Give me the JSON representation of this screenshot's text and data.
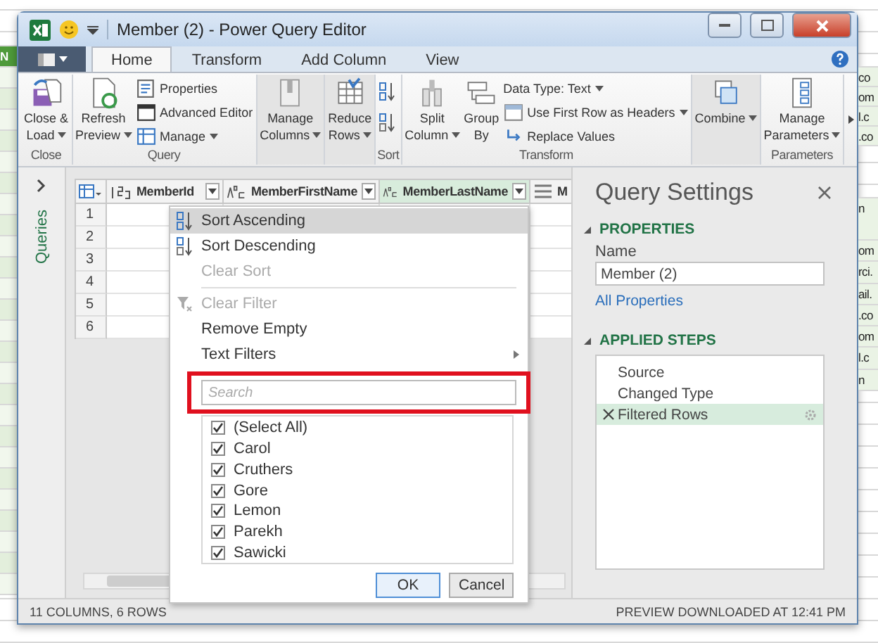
{
  "background_sheet": {
    "left_cell": "N",
    "right_cells_top": [
      "co",
      "om",
      "l.c",
      ".co"
    ],
    "right_cells_lower": [
      "n",
      "om",
      "rci.",
      "ail.",
      ".co",
      "om",
      "l.c",
      "n"
    ]
  },
  "window": {
    "title": "Member (2) - Power Query Editor"
  },
  "tabs": [
    {
      "label": "Home",
      "selected": true
    },
    {
      "label": "Transform",
      "selected": false
    },
    {
      "label": "Add Column",
      "selected": false
    },
    {
      "label": "View",
      "selected": false
    }
  ],
  "ribbon": [
    {
      "label": "Close",
      "items": [
        {
          "kind": "large",
          "lines": [
            "Close &",
            "Load"
          ],
          "dropdown": true
        }
      ]
    },
    {
      "label": "Query",
      "items": [
        {
          "kind": "large",
          "lines": [
            "Refresh",
            "Preview"
          ],
          "dropdown": true
        },
        {
          "kind": "stack",
          "entries": [
            {
              "label": "Properties",
              "dropdown": false
            },
            {
              "label": "Advanced Editor",
              "dropdown": false
            },
            {
              "label": "Manage",
              "dropdown": true
            }
          ]
        }
      ]
    },
    {
      "items": [
        {
          "kind": "large",
          "lines": [
            "Manage",
            "Columns"
          ],
          "dropdown": true
        }
      ]
    },
    {
      "items": [
        {
          "kind": "large",
          "lines": [
            "Reduce",
            "Rows"
          ],
          "dropdown": true
        }
      ]
    },
    {
      "label": "Sort",
      "items": [
        {
          "kind": "sort"
        }
      ]
    },
    {
      "label": "Transform",
      "items": [
        {
          "kind": "large",
          "lines": [
            "Split",
            "Column"
          ],
          "dropdown": true
        },
        {
          "kind": "large",
          "lines": [
            "Group",
            "By"
          ],
          "dropdown": false
        },
        {
          "kind": "stack",
          "entries": [
            {
              "label": "Data Type: Text",
              "dropdown": true
            },
            {
              "label": "Use First Row as Headers",
              "dropdown": true
            },
            {
              "label": "Replace Values",
              "dropdown": false
            }
          ]
        }
      ]
    },
    {
      "items": [
        {
          "kind": "large",
          "lines": [
            "Combine"
          ],
          "dropdown": true
        }
      ]
    },
    {
      "label": "Parameters",
      "items": [
        {
          "kind": "large",
          "lines": [
            "Manage",
            "Parameters"
          ],
          "dropdown": true
        }
      ]
    }
  ],
  "queries_pane": {
    "label": "Queries"
  },
  "table": {
    "columns": [
      {
        "kind": "number",
        "name": "MemberId",
        "selected": false
      },
      {
        "kind": "text",
        "name": "MemberFirstName",
        "selected": false
      },
      {
        "kind": "text",
        "name": "MemberLastName",
        "selected": true
      },
      {
        "kind": "any",
        "name": "M",
        "selected": false
      }
    ],
    "rows": [
      "1",
      "2",
      "3",
      "4",
      "5",
      "6"
    ]
  },
  "filter_menu": {
    "items": [
      {
        "label": "Sort Ascending",
        "kind": "sort_asc",
        "disabled": false,
        "selected": true
      },
      {
        "label": "Sort Descending",
        "kind": "sort_desc",
        "disabled": false,
        "selected": false
      },
      {
        "label": "Clear Sort",
        "kind": "plain",
        "disabled": true,
        "selected": false
      },
      {
        "kind": "separator"
      },
      {
        "label": "Clear Filter",
        "kind": "clear_filter",
        "disabled": true,
        "selected": false
      },
      {
        "label": "Remove Empty",
        "kind": "plain",
        "disabled": false,
        "selected": false
      },
      {
        "label": "Text Filters",
        "kind": "submenu",
        "disabled": false,
        "selected": false
      }
    ],
    "search": {
      "placeholder": "Search",
      "highlighted": true
    },
    "values": [
      {
        "label": "(Select All)",
        "checked": true
      },
      {
        "label": "Carol",
        "checked": true
      },
      {
        "label": "Cruthers",
        "checked": true
      },
      {
        "label": "Gore",
        "checked": true
      },
      {
        "label": "Lemon",
        "checked": true
      },
      {
        "label": "Parekh",
        "checked": true
      },
      {
        "label": "Sawicki",
        "checked": true
      }
    ],
    "buttons": [
      {
        "label": "OK",
        "default": true
      },
      {
        "label": "Cancel",
        "default": false
      }
    ]
  },
  "query_settings": {
    "title": "Query Settings",
    "properties_heading": "PROPERTIES",
    "name_label": "Name",
    "name_value": "Member (2)",
    "all_properties": "All Properties",
    "steps_heading": "APPLIED STEPS",
    "steps": [
      {
        "label": "Source",
        "selected": false
      },
      {
        "label": "Changed Type",
        "selected": false
      },
      {
        "label": "Filtered Rows",
        "selected": true
      }
    ]
  },
  "status_bar": {
    "left": "11 COLUMNS, 6 ROWS",
    "right": "PREVIEW DOWNLOADED AT 12:41 PM"
  }
}
